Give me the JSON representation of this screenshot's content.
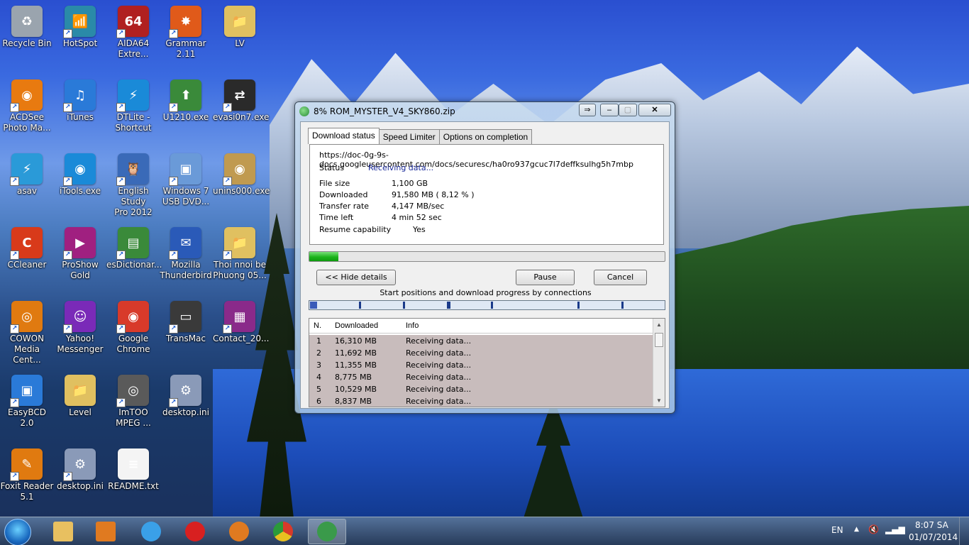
{
  "desktop": {
    "icons": [
      {
        "label": "Recycle Bin",
        "color": "#9aa4ae",
        "glyph": "♻"
      },
      {
        "label": "HotSpot",
        "color": "#2a8aa8",
        "glyph": "📶"
      },
      {
        "label": "AIDA64\nExtre...",
        "color": "#b02020",
        "glyph": "64"
      },
      {
        "label": "Grammar\n2.11",
        "color": "#e05a1a",
        "glyph": "✸"
      },
      {
        "label": "LV",
        "color": "#e0c060",
        "glyph": "📁"
      },
      {
        "label": "ACDSee\nPhoto Ma...",
        "color": "#e87a10",
        "glyph": "◉"
      },
      {
        "label": "iTunes",
        "color": "#2a7ad8",
        "glyph": "♫"
      },
      {
        "label": "DTLite -\nShortcut",
        "color": "#1a8ad8",
        "glyph": "⚡"
      },
      {
        "label": "U1210.exe",
        "color": "#3a8a3a",
        "glyph": "⬆"
      },
      {
        "label": "evasi0n7.exe",
        "color": "#2a2a2a",
        "glyph": "⇄"
      },
      {
        "label": "asav",
        "color": "#2a9ad8",
        "glyph": "⚡"
      },
      {
        "label": "iTools.exe",
        "color": "#1a8ad8",
        "glyph": "◉"
      },
      {
        "label": "English Study\nPro 2012",
        "color": "#3a6ab8",
        "glyph": "🦉"
      },
      {
        "label": "Windows 7\nUSB DVD...",
        "color": "#6a9ad8",
        "glyph": "▣"
      },
      {
        "label": "unins000.exe",
        "color": "#c09a50",
        "glyph": "◉"
      },
      {
        "label": "CCleaner",
        "color": "#d83a1a",
        "glyph": "C"
      },
      {
        "label": "ProShow\nGold",
        "color": "#a02080",
        "glyph": "▶"
      },
      {
        "label": "esDictionar...",
        "color": "#3a8a3a",
        "glyph": "▤"
      },
      {
        "label": "Mozilla\nThunderbird",
        "color": "#2a5ab8",
        "glyph": "✉"
      },
      {
        "label": "Thoi nnoi be\nPhuong 05...",
        "color": "#e0c060",
        "glyph": "📁"
      },
      {
        "label": "COWON\nMedia Cent...",
        "color": "#e07a10",
        "glyph": "◎"
      },
      {
        "label": "Yahoo!\nMessenger",
        "color": "#7a2ab8",
        "glyph": "☺"
      },
      {
        "label": "Google\nChrome",
        "color": "#d83a2a",
        "glyph": "◉"
      },
      {
        "label": "TransMac",
        "color": "#3a3a3a",
        "glyph": "▭"
      },
      {
        "label": "Contact_20...",
        "color": "#8a2a8a",
        "glyph": "▦"
      },
      {
        "label": "EasyBCD 2.0",
        "color": "#2a7ad8",
        "glyph": "▣"
      },
      {
        "label": "Level",
        "color": "#e0c060",
        "glyph": "📁"
      },
      {
        "label": "ImTOO\nMPEG ...",
        "color": "#5a5a5a",
        "glyph": "◎"
      },
      {
        "label": "desktop.ini",
        "color": "#8a9ab8",
        "glyph": "⚙"
      },
      {
        "label": "Foxit Reader\n5.1",
        "color": "#e07a10",
        "glyph": "✎"
      },
      {
        "label": "desktop.ini",
        "color": "#8a9ab8",
        "glyph": "⚙"
      },
      {
        "label": "README.txt",
        "color": "#f4f4f4",
        "glyph": "≡"
      }
    ]
  },
  "window": {
    "title": "8% ROM_MYSTER_V4_SKY860.zip",
    "tabs": [
      "Download status",
      "Speed Limiter",
      "Options on completion"
    ],
    "url": "https://doc-0g-9s-docs.googleusercontent.com/docs/securesc/ha0ro937gcuc7l7deffksulhg5h7mbp",
    "status_label": "Status",
    "status_value": "Receiving data...",
    "file_size_label": "File size",
    "file_size_value": "1,100  GB",
    "downloaded_label": "Downloaded",
    "downloaded_value": "91,580  MB  ( 8,12 % )",
    "transfer_rate_label": "Transfer rate",
    "transfer_rate_value": "4,147  MB/sec",
    "time_left_label": "Time left",
    "time_left_value": "4 min 52 sec",
    "resume_label": "Resume capability",
    "resume_value": "Yes",
    "progress": 0.0812,
    "hide_details": "<< Hide details",
    "pause": "Pause",
    "cancel": "Cancel",
    "connections_caption": "Start positions and download progress by connections",
    "columns": [
      "N.",
      "Downloaded",
      "Info"
    ],
    "rows": [
      {
        "n": "1",
        "downloaded": "16,310  MB",
        "info": "Receiving data..."
      },
      {
        "n": "2",
        "downloaded": "11,692  MB",
        "info": "Receiving data..."
      },
      {
        "n": "3",
        "downloaded": "11,355  MB",
        "info": "Receiving data..."
      },
      {
        "n": "4",
        "downloaded": "8,775  MB",
        "info": "Receiving data..."
      },
      {
        "n": "5",
        "downloaded": "10,529  MB",
        "info": "Receiving data..."
      },
      {
        "n": "6",
        "downloaded": "8,837  MB",
        "info": "Receiving data..."
      }
    ]
  },
  "taskbar": {
    "lang": "EN",
    "time": "8:07 SA",
    "date": "01/07/2014"
  }
}
